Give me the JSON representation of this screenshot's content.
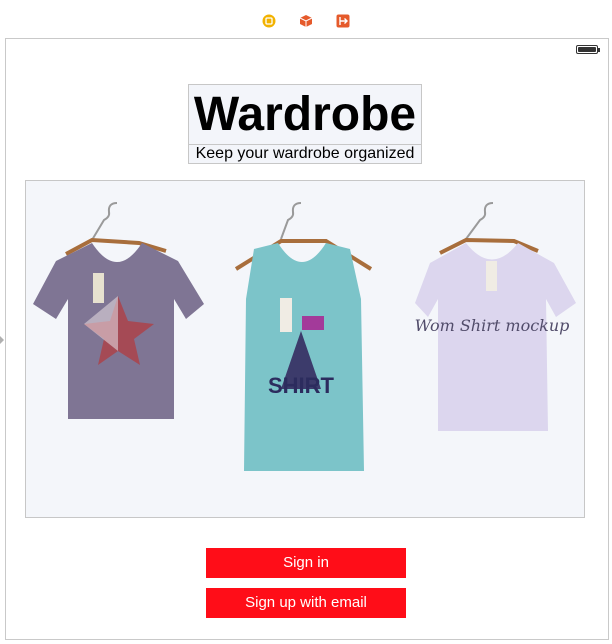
{
  "app": {
    "title": "Wardrobe",
    "subtitle": "Keep your wardrobe organized"
  },
  "toolbar": {
    "icons": [
      "view-controller-icon",
      "cube-icon",
      "exit-icon"
    ]
  },
  "hero": {
    "shirts": [
      {
        "name": "purple-star-tshirt",
        "color": "#7f7594",
        "tag_text": ""
      },
      {
        "name": "teal-tank-top",
        "color": "#7cc4c9",
        "print_text": "SHIRT"
      },
      {
        "name": "lavender-tshirt",
        "color": "#dcd6ee",
        "print_text": "Wom Shirt mockup"
      }
    ]
  },
  "buttons": {
    "sign_in": "Sign in",
    "sign_up": "Sign up with email"
  },
  "colors": {
    "accent": "#ff0d18",
    "title_bg": "#f3f5fa"
  }
}
